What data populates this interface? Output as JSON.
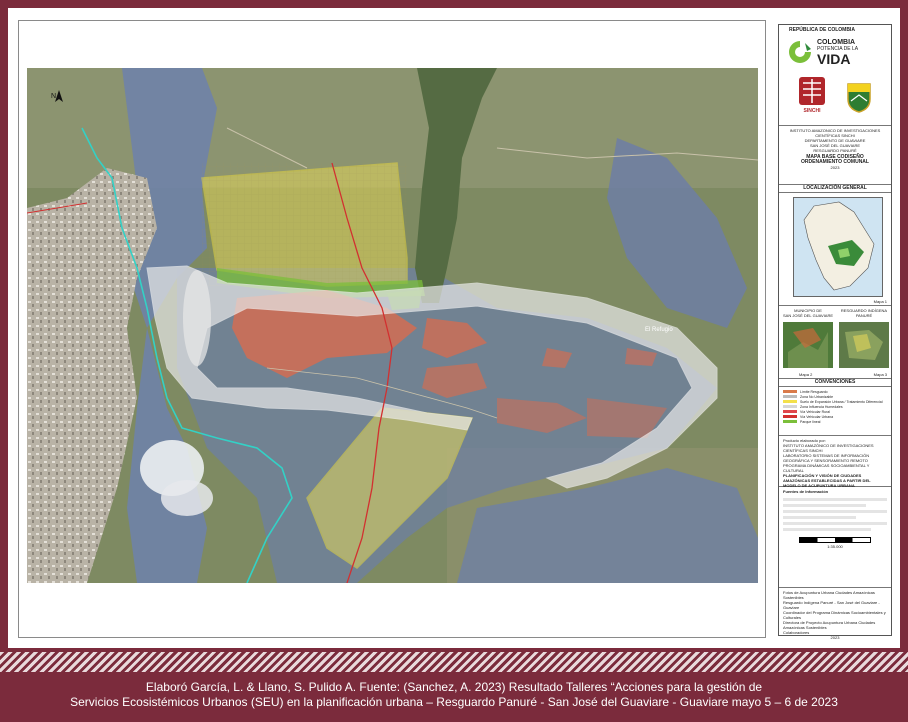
{
  "map": {
    "north_label": "N",
    "place_label": "El Refugio"
  },
  "legend": {
    "country": "REPÚBLICA DE COLOMBIA",
    "brand_line1": "COLOMBIA",
    "brand_line2": "POTENCIA DE LA",
    "brand_line3": "VIDA",
    "institute_logo_text": "SINCHI",
    "org_lines": [
      "INSTITUTO AMAZONICO DE INVESTIGACIONES",
      "CIENTÍFICAS SINCHI",
      "DEPARTAMENTO DE GUAVIARE",
      "SAN JOSÉ DEL GUAVIARE",
      "RESGUARDO PANURÉ"
    ],
    "map_title_line1": "MAPA BASE CODISEÑO",
    "map_title_line2": "ORDENAMIENTO COMUNAL",
    "year": "2023",
    "localizacion_title": "LOCALIZACIÓN GENERAL",
    "mapa1": "Mapa 1",
    "municipio_title_line1": "MUNICIPIO DE",
    "municipio_title_line2": "SAN JOSÉ DEL GUAVIARE",
    "resguardo_title_line1": "RESGUARDO INDÍGENA",
    "resguardo_title_line2": "PANURÉ",
    "mapa2": "Mapa 2",
    "mapa3": "Mapa 3",
    "convenciones_title": "CONVENCIONES",
    "convenciones": [
      {
        "label": "Límite Resguardo",
        "color": "#d97a4a"
      },
      {
        "label": "Zona No Urbanizable",
        "color": "#bbbbbb"
      },
      {
        "label": "Suelo de Expansión Urbana / Tratamiento Diferencial",
        "color": "#f3e04a"
      },
      {
        "label": "Zona Influencia Humedales",
        "color": "#d6d6d6"
      },
      {
        "label": "Vía Vehicular Rural",
        "color": "#e0474c"
      },
      {
        "label": "Vía Vehicular Urbana",
        "color": "#d23030"
      },
      {
        "label": "Parque lineal",
        "color": "#7bbf3a"
      }
    ],
    "credits": [
      "Producto elaborado por:",
      "INSTITUTO AMAZÓNICO DE INVESTIGACIONES CIENTÍFICAS SINCHI",
      "LABORATORIO SISTEMAS DE INFORMACIÓN GEOGRÁFICA Y SENSORAMIENTO REMOTO",
      "PROGRAMA DINÁMICAS SOCIOAMBIENTAL Y CULTURAL",
      "PLANIFICACIÓN Y VISIÓN DE CIUDADES AMAZÓNICAS ESTABLECIDAS A PARTIR DEL MODELO DE ACUPUNTURA URBANA"
    ],
    "fuentes_title": "Fuentes de Información",
    "scale_text": "1:35.000",
    "footer_lines": [
      "Fotos de Acupuntura Urbana Ciudades Amazónicas Sostenibles",
      "Resguardo Indígena Panuré - San José del Guaviare - Guaviare",
      "Coordinador del Programa Dinámicas Socioambientales y Culturales",
      "Directora de Proyecto Acupuntura Urbana Ciudades Amazónicas Sostenibles",
      "Colaboradores"
    ],
    "footer_year": "2023"
  },
  "caption": {
    "line1": "Elaboró García, L. & Llano, S. Pulido A. Fuente: (Sanchez, A. 2023) Resultado Talleres “Acciones para la gestión de",
    "line2": "Servicios Ecosistémicos Urbanos (SEU) en la planificación urbana – Resguardo Panuré - San José del Guaviare - Guaviare mayo 5 – 6  de 2023"
  }
}
